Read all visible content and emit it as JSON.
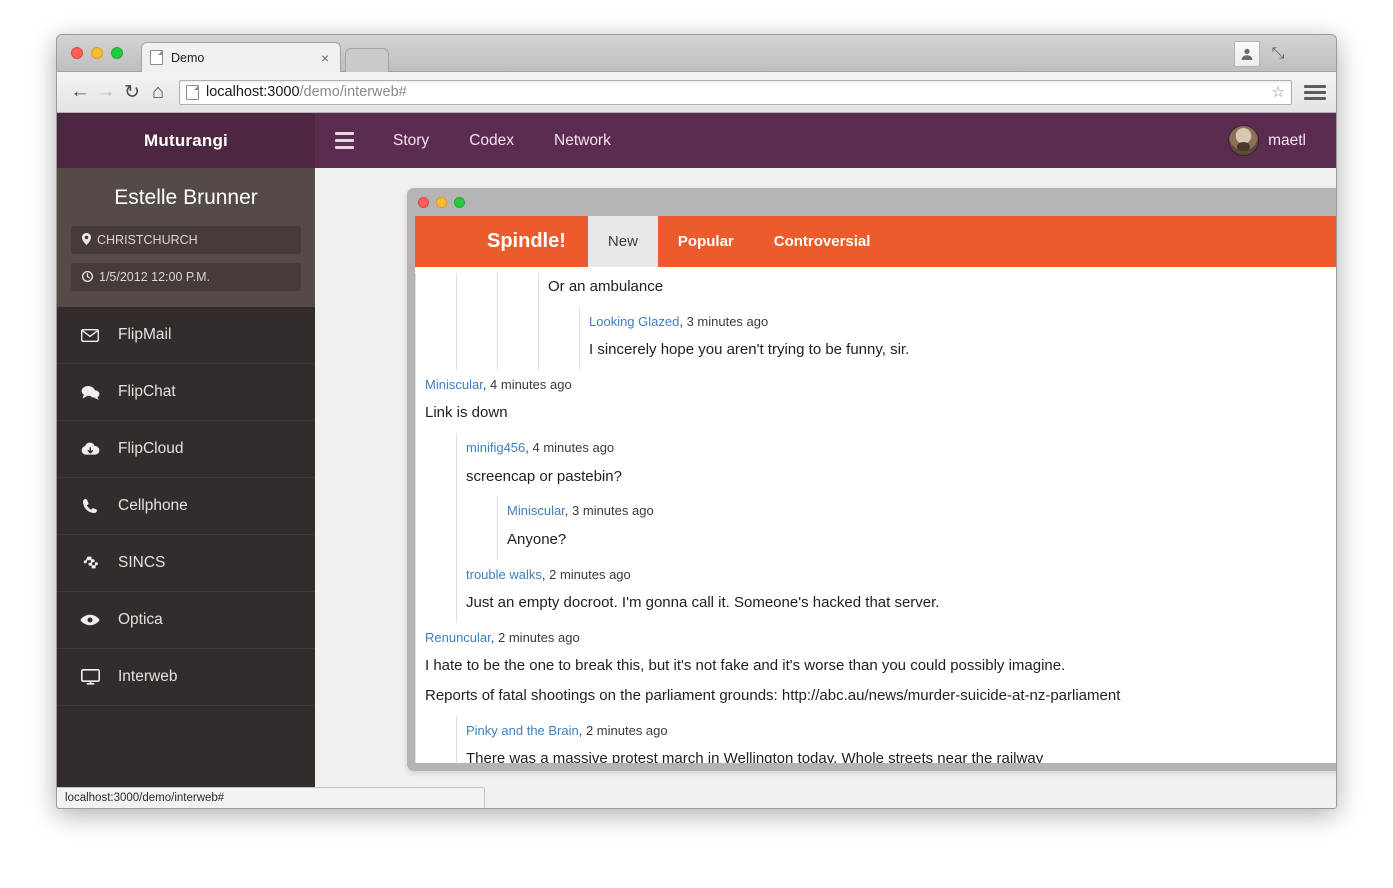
{
  "browser": {
    "tab": {
      "title": "Demo",
      "close_label": "×",
      "favicon": "page-icon"
    },
    "new_tab_label": "",
    "nav": {
      "back": "←",
      "forward": "→",
      "reload": "↻",
      "home": "⌂"
    },
    "omnibox": {
      "url_host": "localhost:3000",
      "url_path": "/demo/interweb#",
      "bookmark_icon": "☆"
    },
    "profile_icon": "person-icon",
    "fullscreen_icon": "⤡",
    "menu_icon": "hamburger-icon",
    "status_text": "localhost:3000/demo/interweb#"
  },
  "app": {
    "brand": "Muturangi",
    "menu_toggle": "hamburger-icon",
    "nav_links": [
      {
        "label": "Story"
      },
      {
        "label": "Codex"
      },
      {
        "label": "Network"
      }
    ],
    "user": {
      "name": "maetl",
      "avatar": "user-avatar"
    },
    "colors": {
      "nav": "#5c2c50",
      "brand": "#4d2742",
      "accent": "#ec5b2b"
    }
  },
  "sidebar": {
    "profile": {
      "name": "Estelle Brunner",
      "location": "CHRISTCHURCH",
      "location_icon": "★",
      "datetime": "1/5/2012 12:00 P.M.",
      "clock_icon": "○"
    },
    "items": [
      {
        "label": "FlipMail",
        "icon": "envelope-icon"
      },
      {
        "label": "FlipChat",
        "icon": "comments-icon"
      },
      {
        "label": "FlipCloud",
        "icon": "cloud-download-icon"
      },
      {
        "label": "Cellphone",
        "icon": "phone-icon"
      },
      {
        "label": "SINCS",
        "icon": "puzzle-icon"
      },
      {
        "label": "Optica",
        "icon": "eye-icon"
      },
      {
        "label": "Interweb",
        "icon": "desktop-icon"
      }
    ]
  },
  "inner_window": {
    "brand": "Spindle!",
    "tabs": [
      {
        "label": "New",
        "active": true
      },
      {
        "label": "Popular",
        "active": false
      },
      {
        "label": "Controversial",
        "active": false
      }
    ],
    "comments": [
      {
        "depth": 4,
        "meta_author": "",
        "meta_time": "",
        "body": "Or an ambulance",
        "show_meta": false
      },
      {
        "depth": 5,
        "meta_author": "Looking Glazed",
        "meta_time": ", 3 minutes ago",
        "body": "I sincerely hope you aren't trying to be funny, sir.",
        "show_meta": true
      },
      {
        "depth": 0,
        "meta_author": "Miniscular",
        "meta_time": ", 4 minutes ago",
        "body": "Link is down",
        "show_meta": true
      },
      {
        "depth": 1,
        "meta_author": "minifig456",
        "meta_time": ", 4 minutes ago",
        "body": "screencap or pastebin?",
        "show_meta": true
      },
      {
        "depth": 2,
        "meta_author": "Miniscular",
        "meta_time": ", 3 minutes ago",
        "body": "Anyone?",
        "show_meta": true
      },
      {
        "depth": 1,
        "meta_author": "trouble walks",
        "meta_time": ", 2 minutes ago",
        "body": "Just an empty docroot. I'm gonna call it. Someone's hacked that server.",
        "show_meta": true
      },
      {
        "depth": 0,
        "meta_author": "Renuncular",
        "meta_time": ", 2 minutes ago",
        "body": "I hate to be the one to break this, but it's not fake and it's worse than you could possibly imagine.",
        "body2": "Reports of fatal shootings on the parliament grounds: http://abc.au/news/murder-suicide-at-nz-parliament",
        "show_meta": true
      },
      {
        "depth": 1,
        "meta_author": "Pinky and the Brain",
        "meta_time": ", 2 minutes ago",
        "body": "There was a massive protest march in Wellington today. Whole streets near the railway",
        "show_meta": true
      }
    ]
  }
}
